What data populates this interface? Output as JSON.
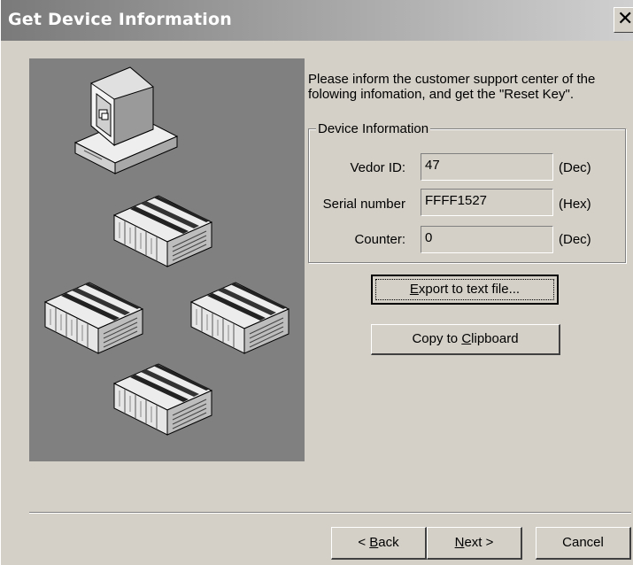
{
  "window": {
    "title": "Get Device Information",
    "close_glyph": "✕"
  },
  "message": "Please inform the customer support center of the folowing infomation, and get the \"Reset Key\".",
  "device_info": {
    "group_label": "Device Information",
    "fields": [
      {
        "label": "Vedor ID:",
        "value": "47",
        "unit": "(Dec)"
      },
      {
        "label": "Serial number",
        "value": "FFFF1527",
        "unit": "(Hex)"
      },
      {
        "label": "Counter:",
        "value": "0",
        "unit": "(Dec)"
      }
    ]
  },
  "buttons": {
    "export": {
      "mnemonic": "E",
      "rest": "xport to text file..."
    },
    "copy": {
      "prefix": "Copy to ",
      "mnemonic": "C",
      "rest": "lipboard"
    },
    "back": {
      "prefix": "< ",
      "mnemonic": "B",
      "rest": "ack"
    },
    "next": {
      "mnemonic": "N",
      "rest": "ext >"
    },
    "cancel": "Cancel"
  },
  "illustration": {
    "icons": [
      "computer-icon",
      "plc-unit-icon",
      "plc-unit-icon",
      "plc-unit-icon",
      "plc-unit-icon"
    ]
  }
}
